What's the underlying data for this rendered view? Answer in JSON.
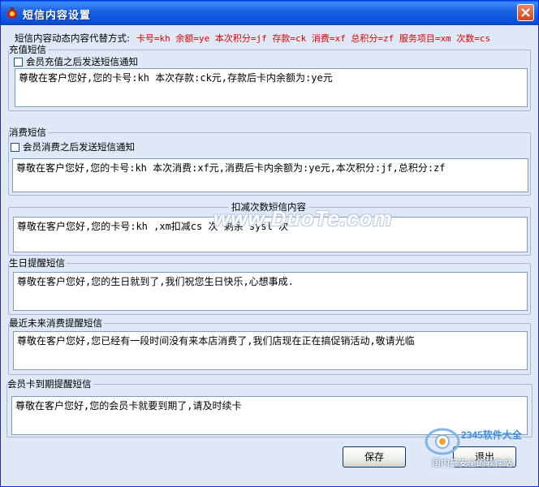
{
  "window": {
    "title": "短信内容设置",
    "close_symbol": "×"
  },
  "hint": {
    "label": "短信内容动态内容代替方式:",
    "codes": "卡号=kh 余额=ye 本次积分=jf 存款=ck 消费=xf 总积分=zf 服务项目=xm 次数=cs"
  },
  "groups": {
    "recharge": {
      "title": "充值短信",
      "checkbox_label": "会员充值之后发送短信通知",
      "checked": false,
      "text": "尊敬在客户您好,您的卡号:kh 本次存款:ck元,存款后卡内余额为:ye元"
    },
    "consume": {
      "title": "消费短信",
      "checkbox_label": "会员消费之后发送短信通知",
      "checked": false,
      "text": "尊敬在客户您好,您的卡号:kh 本次消费:xf元,消费后卡内余额为:ye元,本次积分:jf,总积分:zf"
    },
    "deduct": {
      "title": "扣减次数短信内容",
      "text": "尊敬在客户您好,您的卡号:kh ,xm扣减cs 次 剩余 sysl 次"
    },
    "birthday": {
      "title": "生日提醒短信",
      "text": "尊敬在客户您好,您的生日就到了,我们祝您生日快乐,心想事成."
    },
    "inactive": {
      "title": "最近未来消费提醒短信",
      "text": "尊敬在客户您好,您已经有一段时间没有来本店消费了,我们店现在正在搞促销活动,敬请光临"
    },
    "expire": {
      "title": "会员卡到期提醒短信",
      "text": "尊敬在客户您好,您的会员卡就要到期了,请及时续卡"
    }
  },
  "buttons": {
    "save": "保存",
    "exit": "退出"
  },
  "watermark": "www.DuoTe.com",
  "brand": {
    "name": "2345软件大全",
    "slogan": "国内最安全的软件站"
  },
  "colors": {
    "title_bar": "#0a4fd8",
    "hint_codes": "#e00000",
    "client_bg": "#dfe8f6"
  },
  "icons": {
    "app": "app-icon",
    "close": "close-icon",
    "brand": "brand-logo-icon"
  }
}
